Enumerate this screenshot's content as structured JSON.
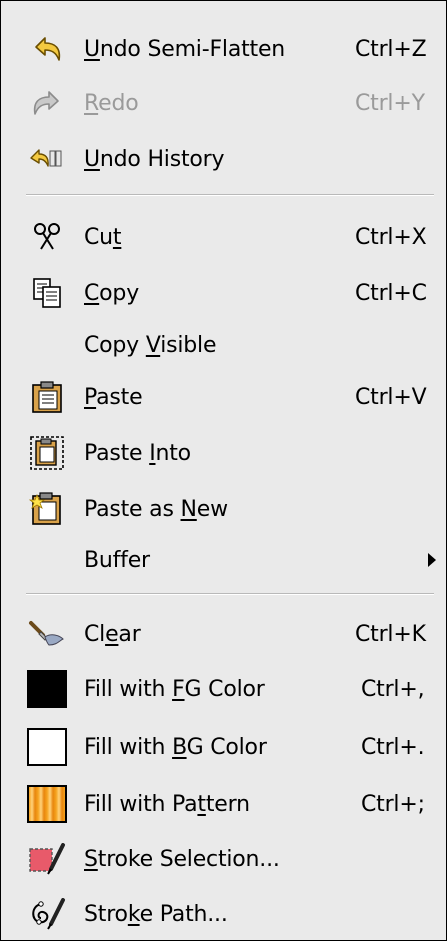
{
  "menu": {
    "items": [
      {
        "pre": "",
        "u": "U",
        "post": "ndo Semi-Flatten",
        "accel": "Ctrl+Z",
        "icon": "undo-arrow-icon",
        "disabled": false
      },
      {
        "pre": "",
        "u": "R",
        "post": "edo",
        "accel": "Ctrl+Y",
        "icon": "redo-arrow-icon",
        "disabled": true
      },
      {
        "pre": "",
        "u": "U",
        "post": "ndo History",
        "accel": "",
        "icon": "undo-history-icon",
        "disabled": false
      },
      {
        "pre": "Cu",
        "u": "t",
        "post": "",
        "accel": "Ctrl+X",
        "icon": "scissors-icon",
        "disabled": false
      },
      {
        "pre": "",
        "u": "C",
        "post": "opy",
        "accel": "Ctrl+C",
        "icon": "copy-icon",
        "disabled": false
      },
      {
        "pre": "Copy ",
        "u": "V",
        "post": "isible",
        "accel": "",
        "icon": "",
        "disabled": false
      },
      {
        "pre": "",
        "u": "P",
        "post": "aste",
        "accel": "Ctrl+V",
        "icon": "clipboard-icon",
        "disabled": false
      },
      {
        "pre": "Paste ",
        "u": "I",
        "post": "nto",
        "accel": "",
        "icon": "paste-into-icon",
        "disabled": false
      },
      {
        "pre": "Paste as ",
        "u": "N",
        "post": "ew",
        "accel": "",
        "icon": "paste-new-icon",
        "disabled": false
      },
      {
        "pre": "Buffer",
        "u": "",
        "post": "",
        "accel": "",
        "icon": "",
        "disabled": false,
        "submenu": true
      },
      {
        "pre": "Cl",
        "u": "e",
        "post": "ar",
        "accel": "Ctrl+K",
        "icon": "eraser-brush-icon",
        "disabled": false
      },
      {
        "pre": "Fill with ",
        "u": "F",
        "post": "G Color",
        "accel": "Ctrl+,",
        "icon": "fg-color-swatch-icon",
        "disabled": false
      },
      {
        "pre": "Fill with ",
        "u": "B",
        "post": "G Color",
        "accel": "Ctrl+.",
        "icon": "bg-color-swatch-icon",
        "disabled": false
      },
      {
        "pre": "Fill with Pa",
        "u": "t",
        "post": "tern",
        "accel": "Ctrl+;",
        "icon": "pattern-swatch-icon",
        "disabled": false
      },
      {
        "pre": "",
        "u": "S",
        "post": "troke Selection...",
        "accel": "",
        "icon": "stroke-selection-icon",
        "disabled": false
      },
      {
        "pre": "Stro",
        "u": "k",
        "post": "e Path...",
        "accel": "",
        "icon": "stroke-path-icon",
        "disabled": false
      }
    ]
  },
  "colors": {
    "fg": "#000000",
    "bg": "#ffffff",
    "pattern": "#f08c1c"
  }
}
